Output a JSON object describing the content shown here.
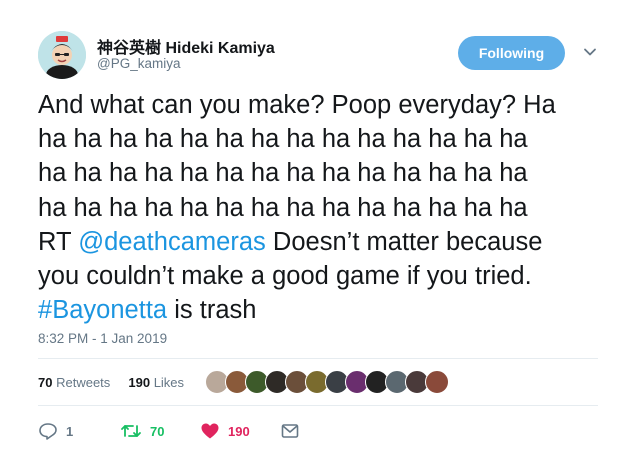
{
  "user": {
    "name": "神谷英樹 Hideki Kamiya",
    "handle": "@PG_kamiya"
  },
  "follow_button": {
    "label": "Following"
  },
  "tweet": {
    "lines": [
      "And what can you make? Poop everyday? Ha",
      "ha ha ha ha ha ha ha ha ha ha ha ha ha ha",
      "ha ha ha ha ha ha ha ha ha ha ha ha ha ha",
      "ha ha ha ha ha ha ha ha ha ha ha ha ha ha"
    ],
    "rt_prefix": "RT ",
    "mention": "@deathcameras",
    "rt_text_1": " Doesn’t matter because",
    "line_6": "you couldn’t make a good game if you tried.",
    "hashtag": "#Bayonetta",
    "tail": " is trash"
  },
  "timestamp": "8:32 PM - 1 Jan 2019",
  "stats": {
    "retweets_count": "70",
    "retweets_label": "Retweets",
    "likes_count": "190",
    "likes_label": "Likes"
  },
  "likers": [
    {
      "name": "liker-1",
      "color": "#b9a89a"
    },
    {
      "name": "liker-2",
      "color": "#8a5a3a"
    },
    {
      "name": "liker-3",
      "color": "#3d5a2a"
    },
    {
      "name": "liker-4",
      "color": "#2e2a26"
    },
    {
      "name": "liker-5",
      "color": "#6b4f3a"
    },
    {
      "name": "liker-6",
      "color": "#7a6b2e"
    },
    {
      "name": "liker-7",
      "color": "#3a3f45"
    },
    {
      "name": "liker-8",
      "color": "#6a2e6e"
    },
    {
      "name": "liker-9",
      "color": "#222222"
    },
    {
      "name": "liker-10",
      "color": "#5b6870"
    },
    {
      "name": "liker-11",
      "color": "#4a3a3a"
    },
    {
      "name": "liker-12",
      "color": "#8a4a3a"
    }
  ],
  "actions": {
    "replies": "1",
    "retweets": "70",
    "likes": "190"
  },
  "colors": {
    "accent": "#1b95e0",
    "retweet_green": "#17bf63",
    "like_red": "#e0245e",
    "muted": "#657786"
  },
  "icons": [
    "reply-icon",
    "retweet-icon",
    "heart-icon",
    "envelope-icon",
    "chevron-down-icon"
  ]
}
